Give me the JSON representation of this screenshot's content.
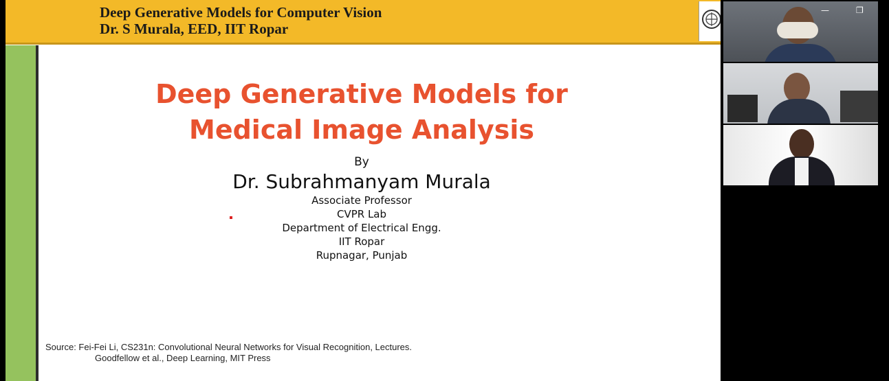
{
  "header": {
    "title": "Deep Generative Models for Computer Vision",
    "subtitle": "Dr. S Murala, EED, IIT Ropar"
  },
  "slide": {
    "title_line1": "Deep Generative Models for",
    "title_line2": "Medical Image Analysis",
    "by": "By",
    "author": "Dr. Subrahmanyam Murala",
    "affiliation": [
      "Associate Professor",
      "CVPR Lab",
      "Department of Electrical Engg.",
      "IIT Ropar",
      "Rupnagar, Punjab"
    ],
    "source_line1": "Source: Fei-Fei Li, CS231n: Convolutional Neural Networks for Visual Recognition, Lectures.",
    "source_line2": "Goodfellow et al., Deep Learning, MIT Press"
  },
  "window_controls": {
    "minimize": "—",
    "restore": "❐"
  },
  "colors": {
    "header_bg": "#f3b928",
    "side_bar": "#95c25e",
    "title": "#e8522f"
  }
}
